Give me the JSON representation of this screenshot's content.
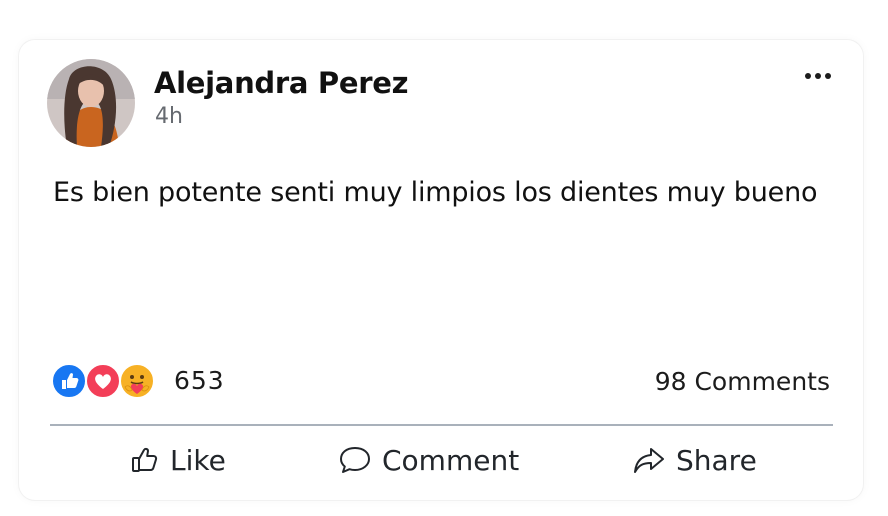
{
  "post": {
    "author": "Alejandra Perez",
    "time": "4h",
    "text": "Es bien potente senti muy limpios los dientes muy bueno"
  },
  "reactions": {
    "types": [
      "like-icon",
      "love-icon",
      "care-icon"
    ],
    "count": "653"
  },
  "comments_count": "98 Comments",
  "actions": {
    "like": "Like",
    "comment": "Comment",
    "share": "Share"
  },
  "colors": {
    "like_blue": "#1877f2",
    "love_red": "#f33e58",
    "care_yellow": "#f7b125",
    "divider": "#a9b1bb"
  }
}
